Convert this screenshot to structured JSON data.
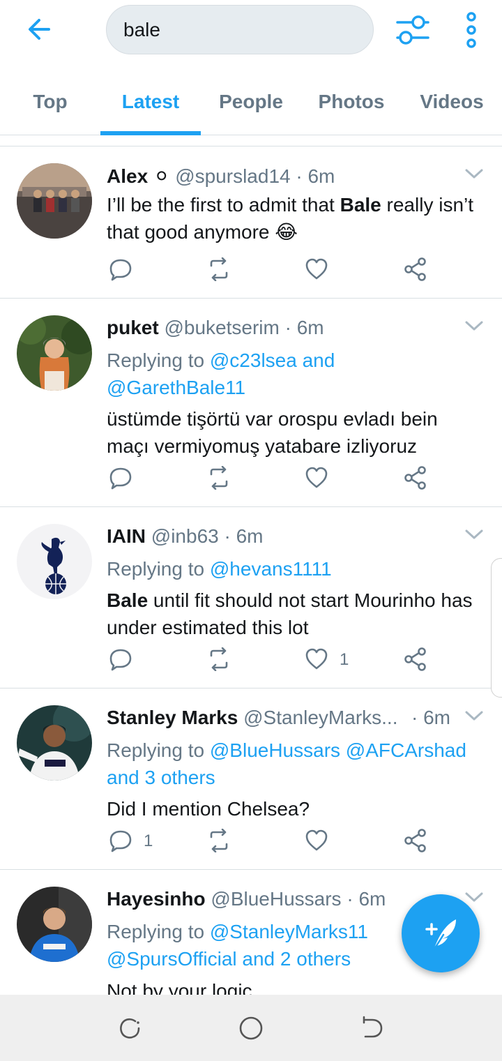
{
  "search": {
    "query": "bale"
  },
  "tabs": [
    {
      "label": "Top",
      "active": false
    },
    {
      "label": "Latest",
      "active": true
    },
    {
      "label": "People",
      "active": false
    },
    {
      "label": "Photos",
      "active": false
    },
    {
      "label": "Videos",
      "active": false
    }
  ],
  "colors": {
    "accent": "#1da1f2",
    "muted": "#657786",
    "text": "#14171a"
  },
  "tweets": [
    {
      "name": "Alex",
      "badge": "⚪",
      "handle": "@spurslad14",
      "time": "6m",
      "text_pre": "I’ll be the first to admit that ",
      "text_bold": "Bale",
      "text_post": " really isn’t that good anymore 😂",
      "reply_count": "",
      "like_count": ""
    },
    {
      "name": "puket",
      "handle": "@buketserim",
      "time": "6m",
      "reply_label": "Replying to ",
      "reply_targets": "@c23lsea and",
      "reply_targets_2": "@GarethBale11",
      "text": "üstümde tişörtü var orospu evladı bein maçı vermiyomuş yatabare izliyoruz"
    },
    {
      "name": "IAIN",
      "handle": "@inb63",
      "time": "6m",
      "reply_label": "Replying to ",
      "reply_targets": "@hevans1111",
      "text_bold": "Bale",
      "text_post": " until fit should not start Mourinho has under estimated this lot",
      "like_count": "1"
    },
    {
      "name": "Stanley Marks",
      "handle": "@StanleyMarks...",
      "time": "6m",
      "reply_label": "Replying to ",
      "reply_targets": "@BlueHussars @AFCArshad",
      "reply_targets_2": "and 3 others",
      "text": "Did I mention Chelsea?",
      "reply_count": "1"
    },
    {
      "name": "Hayesinho",
      "handle": "@BlueHussars",
      "time": "6m",
      "reply_label": "Replying to ",
      "reply_targets": "@StanleyMarks11",
      "reply_targets_2": "@SpursOfficial and 2 others",
      "text": "Not by your logic"
    }
  ]
}
